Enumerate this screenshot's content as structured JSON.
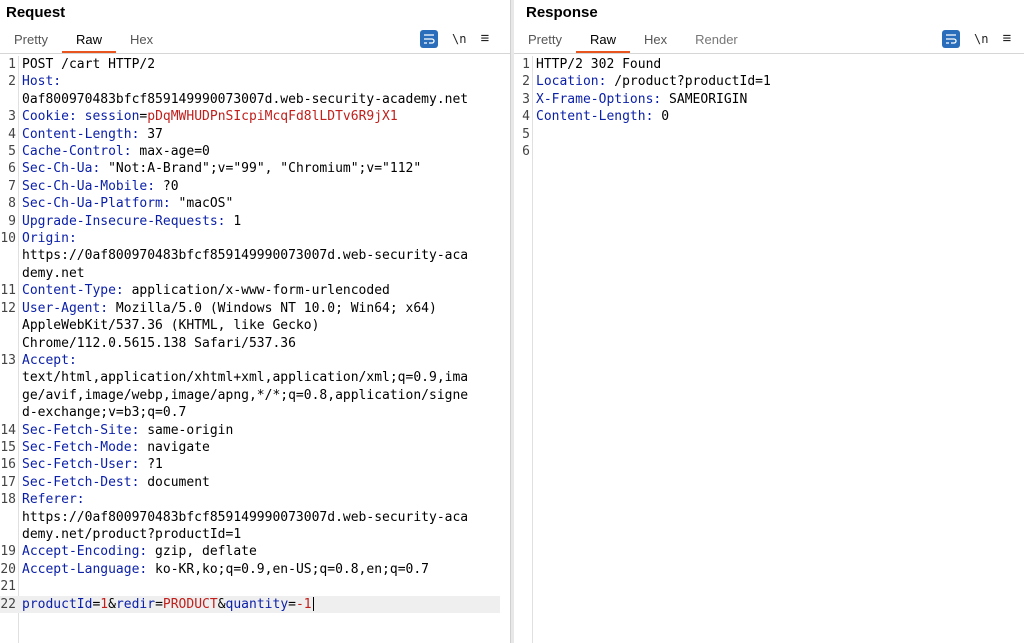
{
  "request": {
    "title": "Request",
    "tabs": [
      "Pretty",
      "Raw",
      "Hex"
    ],
    "active_tab": "Raw",
    "newline_label": "\\n",
    "menu_label": "≡",
    "lines": [
      {
        "n": "1",
        "parts": [
          {
            "t": "POST /cart HTTP/2",
            "c": "plain"
          }
        ]
      },
      {
        "n": "2",
        "parts": [
          {
            "t": "Host:",
            "c": "hname"
          }
        ],
        "cont": [
          "0af800970483bfcf859149990073007d.web-security-academy.net"
        ]
      },
      {
        "n": "3",
        "parts": [
          {
            "t": "Cookie:",
            "c": "hname"
          },
          {
            "t": " ",
            "c": "plain"
          },
          {
            "t": "session",
            "c": "hname"
          },
          {
            "t": "=",
            "c": "plain"
          },
          {
            "t": "pDqMWHUDPnSIcpiMcqFd8lLDTv6R9jX1",
            "c": "cookie-val"
          }
        ]
      },
      {
        "n": "4",
        "parts": [
          {
            "t": "Content-Length:",
            "c": "hname"
          },
          {
            "t": " 37",
            "c": "plain"
          }
        ]
      },
      {
        "n": "5",
        "parts": [
          {
            "t": "Cache-Control:",
            "c": "hname"
          },
          {
            "t": " max-age=0",
            "c": "plain"
          }
        ]
      },
      {
        "n": "6",
        "parts": [
          {
            "t": "Sec-Ch-Ua:",
            "c": "hname"
          },
          {
            "t": " \"Not:A-Brand\";v=\"99\", \"Chromium\";v=\"112\"",
            "c": "plain"
          }
        ]
      },
      {
        "n": "7",
        "parts": [
          {
            "t": "Sec-Ch-Ua-Mobile:",
            "c": "hname"
          },
          {
            "t": " ?0",
            "c": "plain"
          }
        ]
      },
      {
        "n": "8",
        "parts": [
          {
            "t": "Sec-Ch-Ua-Platform:",
            "c": "hname"
          },
          {
            "t": " \"macOS\"",
            "c": "plain"
          }
        ]
      },
      {
        "n": "9",
        "parts": [
          {
            "t": "Upgrade-Insecure-Requests:",
            "c": "hname"
          },
          {
            "t": " 1",
            "c": "plain"
          }
        ]
      },
      {
        "n": "10",
        "parts": [
          {
            "t": "Origin:",
            "c": "hname"
          }
        ],
        "cont": [
          "https://0af800970483bfcf859149990073007d.web-security-aca",
          "demy.net"
        ]
      },
      {
        "n": "11",
        "parts": [
          {
            "t": "Content-Type:",
            "c": "hname"
          },
          {
            "t": " application/x-www-form-urlencoded",
            "c": "plain"
          }
        ]
      },
      {
        "n": "12",
        "parts": [
          {
            "t": "User-Agent:",
            "c": "hname"
          },
          {
            "t": " Mozilla/5.0 (Windows NT 10.0; Win64; x64)",
            "c": "plain"
          }
        ],
        "cont": [
          "AppleWebKit/537.36 (KHTML, like Gecko)",
          "Chrome/112.0.5615.138 Safari/537.36"
        ]
      },
      {
        "n": "13",
        "parts": [
          {
            "t": "Accept:",
            "c": "hname"
          }
        ],
        "cont": [
          "text/html,application/xhtml+xml,application/xml;q=0.9,ima",
          "ge/avif,image/webp,image/apng,*/*;q=0.8,application/signe",
          "d-exchange;v=b3;q=0.7"
        ]
      },
      {
        "n": "14",
        "parts": [
          {
            "t": "Sec-Fetch-Site:",
            "c": "hname"
          },
          {
            "t": " same-origin",
            "c": "plain"
          }
        ]
      },
      {
        "n": "15",
        "parts": [
          {
            "t": "Sec-Fetch-Mode:",
            "c": "hname"
          },
          {
            "t": " navigate",
            "c": "plain"
          }
        ]
      },
      {
        "n": "16",
        "parts": [
          {
            "t": "Sec-Fetch-User:",
            "c": "hname"
          },
          {
            "t": " ?1",
            "c": "plain"
          }
        ]
      },
      {
        "n": "17",
        "parts": [
          {
            "t": "Sec-Fetch-Dest:",
            "c": "hname"
          },
          {
            "t": " document",
            "c": "plain"
          }
        ]
      },
      {
        "n": "18",
        "parts": [
          {
            "t": "Referer:",
            "c": "hname"
          }
        ],
        "cont": [
          "https://0af800970483bfcf859149990073007d.web-security-aca",
          "demy.net/product?productId=1"
        ]
      },
      {
        "n": "19",
        "parts": [
          {
            "t": "Accept-Encoding:",
            "c": "hname"
          },
          {
            "t": " gzip, deflate",
            "c": "plain"
          }
        ]
      },
      {
        "n": "20",
        "parts": [
          {
            "t": "Accept-Language:",
            "c": "hname"
          },
          {
            "t": " ko-KR,ko;q=0.9,en-US;q=0.8,en;q=0.7",
            "c": "plain"
          }
        ]
      },
      {
        "n": "21",
        "parts": []
      },
      {
        "n": "22",
        "current": true,
        "parts": [
          {
            "t": "productId",
            "c": "body-key"
          },
          {
            "t": "=",
            "c": "plain"
          },
          {
            "t": "1",
            "c": "body-val"
          },
          {
            "t": "&",
            "c": "plain"
          },
          {
            "t": "redir",
            "c": "body-key"
          },
          {
            "t": "=",
            "c": "plain"
          },
          {
            "t": "PRODUCT",
            "c": "body-val"
          },
          {
            "t": "&",
            "c": "plain"
          },
          {
            "t": "quantity",
            "c": "body-key"
          },
          {
            "t": "=",
            "c": "plain"
          },
          {
            "t": "-1",
            "c": "body-val"
          }
        ]
      }
    ]
  },
  "response": {
    "title": "Response",
    "tabs": [
      "Pretty",
      "Raw",
      "Hex",
      "Render"
    ],
    "active_tab": "Raw",
    "newline_label": "\\n",
    "menu_label": "≡",
    "lines": [
      {
        "n": "1",
        "parts": [
          {
            "t": "HTTP/2 302 Found",
            "c": "plain"
          }
        ]
      },
      {
        "n": "2",
        "parts": [
          {
            "t": "Location:",
            "c": "hname"
          },
          {
            "t": " /product?productId=1",
            "c": "plain"
          }
        ]
      },
      {
        "n": "3",
        "parts": [
          {
            "t": "X-Frame-Options:",
            "c": "hname"
          },
          {
            "t": " SAMEORIGIN",
            "c": "plain"
          }
        ]
      },
      {
        "n": "4",
        "parts": [
          {
            "t": "Content-Length:",
            "c": "hname"
          },
          {
            "t": " 0",
            "c": "plain"
          }
        ]
      },
      {
        "n": "5",
        "parts": []
      },
      {
        "n": "6",
        "parts": []
      }
    ]
  },
  "colors": {
    "header_name": "#0a1fa8",
    "value_red": "#c0201c",
    "accent_tab": "#e8551f",
    "button_blue": "#2a6ebb"
  },
  "icons": {
    "wrap": "wrap-lines-icon",
    "layout": [
      "layout-side-by-side-icon",
      "layout-horizontal-icon",
      "layout-single-icon"
    ]
  }
}
